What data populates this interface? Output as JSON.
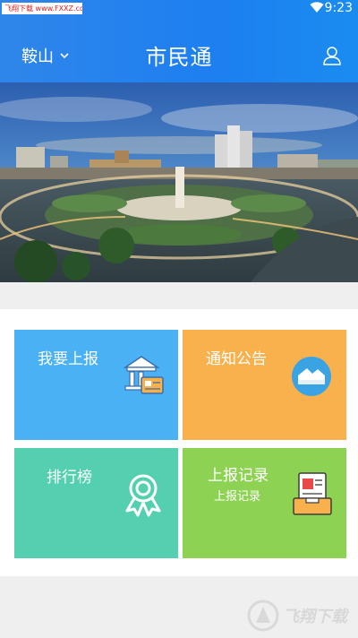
{
  "status_bar": {
    "watermark": "飞翔下载 www.FXXZ.com",
    "time": "9:23"
  },
  "header": {
    "city": "鞍山",
    "title": "市民通"
  },
  "banner": {
    "alt": "city-square-night"
  },
  "tiles": [
    {
      "label": "我要上报",
      "icon": "bank-card-icon",
      "color": "#49b1f4"
    },
    {
      "label": "通知公告",
      "icon": "envelope-icon",
      "color": "#f8b14d"
    },
    {
      "label": "排行榜",
      "icon": "award-ribbon-icon",
      "color": "#54d0b0"
    },
    {
      "label": "上报记录",
      "sublabel": "上报记录",
      "icon": "clipboard-icon",
      "color": "#8dd253"
    }
  ],
  "footer": {
    "watermark": "飞翔下载"
  }
}
